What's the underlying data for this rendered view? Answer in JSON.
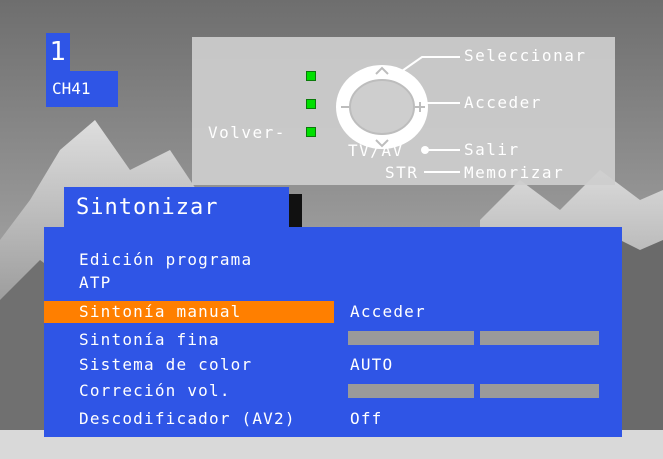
{
  "channel": {
    "number": "1",
    "name": "CH41"
  },
  "help": {
    "select": "Seleccionar",
    "access": "Acceder",
    "back": "Volver-",
    "tvav": "TV/AV",
    "exit": "Salir",
    "str": "STR",
    "store": "Memorizar"
  },
  "menu": {
    "title": "Sintonizar",
    "items": [
      {
        "label": "Edición programa",
        "value": ""
      },
      {
        "label": "ATP",
        "value": ""
      },
      {
        "label": "Sintonía manual",
        "value": "Acceder",
        "selected": true
      },
      {
        "label": "Sintonía fina",
        "value": ""
      },
      {
        "label": "Sistema de color",
        "value": "AUTO"
      },
      {
        "label": "Correción vol.",
        "value": ""
      },
      {
        "label": "Descodificador (AV2)",
        "value": "Off"
      }
    ]
  },
  "colors": {
    "menu_blue": "#2f55e6",
    "highlight": "#ff7f00",
    "led": "#00e000"
  }
}
